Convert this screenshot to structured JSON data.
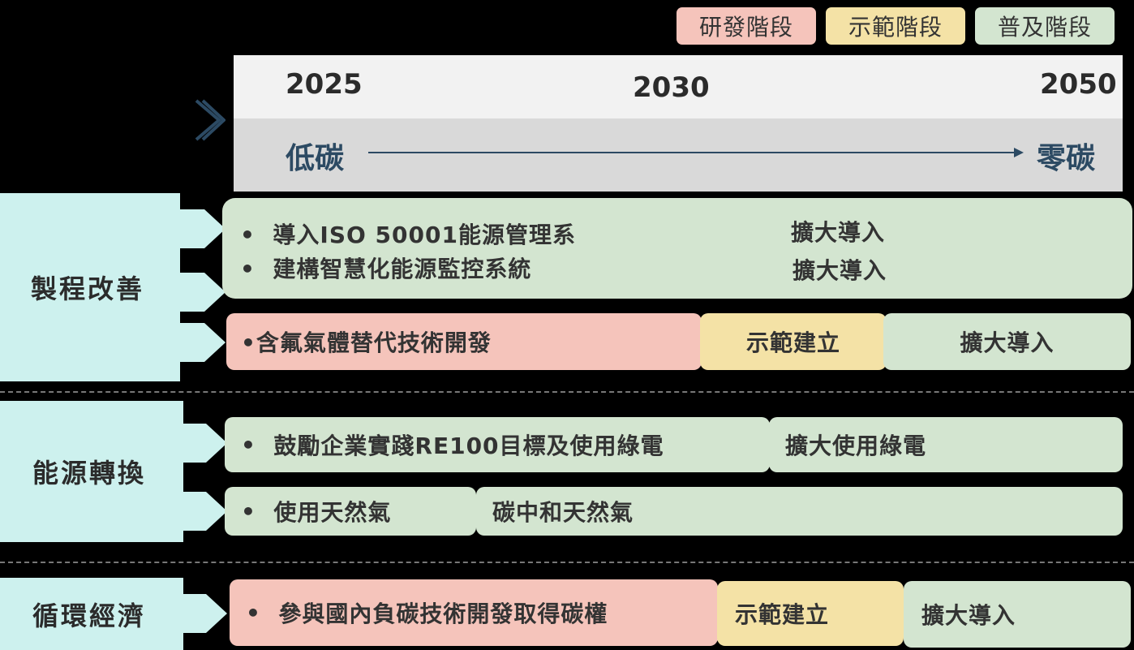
{
  "legend": [
    {
      "label": "研發階段",
      "color": "#f5c4bb"
    },
    {
      "label": "示範階段",
      "color": "#f4e2a6"
    },
    {
      "label": "普及階段",
      "color": "#d3e5d0"
    }
  ],
  "timeline": {
    "years": [
      "2025",
      "2030",
      "2050"
    ],
    "start": "低碳",
    "end": "零碳"
  },
  "categories": {
    "process": "製程改善",
    "energy": "能源轉換",
    "circular": "循環經濟"
  },
  "process": {
    "item1": "導入ISO 50001能源管理系",
    "item1_next": "擴大導入",
    "item2": "建構智慧化能源監控系統",
    "item2_next": "擴大導入",
    "item3": "•含氟氣體替代技術開發",
    "item3_demo": "示範建立",
    "item3_next": "擴大導入"
  },
  "energy": {
    "item1": "鼓勵企業實踐RE100目標及使用綠電",
    "item1_next": "擴大使用綠電",
    "item2": "使用天然氣",
    "item2_next": "碳中和天然氣"
  },
  "circular": {
    "item1": "參與國內負碳技術開發取得碳權",
    "item1_demo": "示範建立",
    "item1_next": "擴大導入"
  },
  "bullet": "•"
}
